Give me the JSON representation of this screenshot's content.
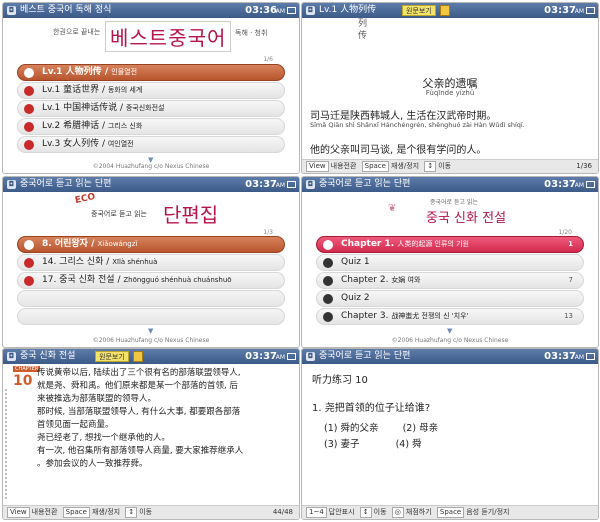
{
  "common": {
    "time": "03:36",
    "time_ampm": "AM",
    "time2": "03:37"
  },
  "screen1": {
    "title": "베스트 중국어 독해 정식",
    "tag_left": "한권으로 끝내는",
    "big_title": "베스트중국어",
    "tag_right": "독해 · 청취",
    "page": "1/6",
    "items": [
      {
        "label": "Lv.1 人物列传",
        "sub": "인물열전"
      },
      {
        "label": "Lv.1 童话世界",
        "sub": "동화의 세계"
      },
      {
        "label": "Lv.1 中国神话传说",
        "sub": "중국신화전설"
      },
      {
        "label": "Lv.2 希腊神话",
        "sub": "그리스 신화"
      },
      {
        "label": "Lv.3 女人列传",
        "sub": "여인열전"
      }
    ],
    "footer": "©2004 Huazhufang c/o Nexus Chinese"
  },
  "screen2": {
    "title": "Lv.1 人物列传",
    "badge": "원문보기",
    "top_chars": [
      "列",
      "传"
    ],
    "heading_zh": "父亲的遗嘱",
    "heading_py": "Fùqīnde yízhǔ",
    "lines": [
      {
        "zh": "司马迁是陕西韩城人, 生活在汉武帝时期。",
        "py": "Sīmǎ Qiān shì Shǎnxī Hánchéngrén, shēnghuó zài Hàn Wǔdì shíqī."
      },
      {
        "zh": "他的父亲叫司马谈, 是个很有学问的人。",
        "py": ""
      }
    ],
    "footer_keys": [
      {
        "key": "View",
        "label": "내용전환"
      },
      {
        "key": "Space",
        "label": "재생/정지"
      },
      {
        "key": "↕",
        "label": "이동"
      }
    ],
    "page": "1/36"
  },
  "screen3": {
    "title": "중국어로 듣고 읽는 단편",
    "eco": "ECO",
    "tag_left": "중국어로 듣고 읽는",
    "big_title": "단편집",
    "page": "1/3",
    "items": [
      {
        "label": "8. 어린왕자",
        "sub": "Xiǎowángzǐ"
      },
      {
        "label": "14. 그리스 신화",
        "sub": "Xīlà shénhuà"
      },
      {
        "label": "17. 중국 신화 전설",
        "sub": "Zhōngguó shénhuà chuánshuō"
      }
    ],
    "footer": "©2006 Huazhufang c/o Nexus Chinese"
  },
  "screen4": {
    "title": "중국어로 듣고 읽는 단편",
    "tag_small": "중국어로 듣고 읽는",
    "big_title": "중국 신화 전설",
    "page": "1/20",
    "items": [
      {
        "label": "Chapter 1.",
        "sub": "人类的起源 인류의 기원",
        "num": "1"
      },
      {
        "label": "Quiz 1",
        "sub": "",
        "num": ""
      },
      {
        "label": "Chapter 2.",
        "sub": "女娲 여와",
        "num": "7"
      },
      {
        "label": "Quiz 2",
        "sub": "",
        "num": ""
      },
      {
        "label": "Chapter 3.",
        "sub": "战神蚩尤 전쟁의 신 '치우'",
        "num": "13"
      }
    ],
    "footer": "©2006 Huazhufang c/o Nexus Chinese"
  },
  "screen5": {
    "title": "중국 신화 전설",
    "badge": "원문보기",
    "chapter_label": "CHAPTER",
    "chapter_num": "10",
    "lines": [
      "传说黄帝以后, 陆续出了三个很有名的部落联盟领导人,",
      "就是尧、舜和禹。他们原来都是某一个部落的首领, 后",
      "来被推选为部落联盟的领导人。",
      "那时候, 当部落联盟领导人, 有什么大事, 都要跟各部落",
      "首领见面一起商量。",
      "尧已经老了, 想找一个继承他的人。",
      "有一次, 他召集所有部落领导人商量, 要大家推荐继承人",
      "。参加会议的人一致推荐舜。"
    ],
    "footer_keys": [
      {
        "key": "View",
        "label": "내용전환"
      },
      {
        "key": "Space",
        "label": "재생/정지"
      },
      {
        "key": "↕",
        "label": "이동"
      }
    ],
    "page": "44/48"
  },
  "screen6": {
    "title": "중국어로 듣고 읽는 단편",
    "section": "听力练习 10",
    "question": "1. 尧把首领的位子让给谁?",
    "options": [
      {
        "n": "(1)",
        "t": "舜的父亲"
      },
      {
        "n": "(2)",
        "t": "母亲"
      },
      {
        "n": "(3)",
        "t": "妻子"
      },
      {
        "n": "(4)",
        "t": "舜"
      }
    ],
    "footer_keys": [
      {
        "key": "1~4",
        "label": "답안표시"
      },
      {
        "key": "↕",
        "label": "이동"
      },
      {
        "key": "◎",
        "label": "채점하기"
      },
      {
        "key": "Space",
        "label": "음성 듣기/정지"
      }
    ]
  }
}
